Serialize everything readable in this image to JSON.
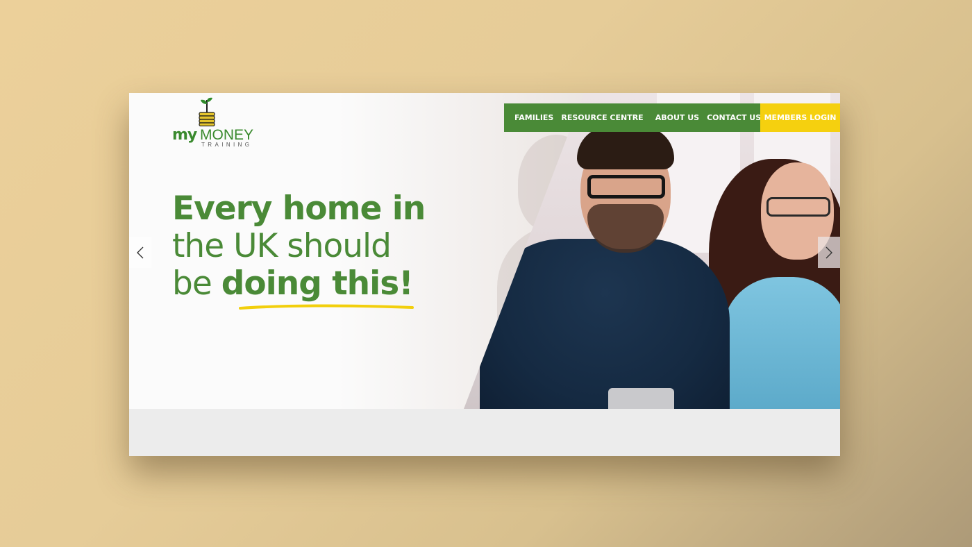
{
  "brand": {
    "logo_my": "my",
    "logo_money": "MONEY",
    "logo_sub": "TRAINING"
  },
  "nav": {
    "items": [
      "FAMILIES",
      "RESOURCE CENTRE",
      "ABOUT US",
      "CONTACT US"
    ],
    "login": "MEMBERS LOGIN"
  },
  "hero": {
    "line1": "Every home in",
    "line2": "the UK should",
    "line3_plain": "be",
    "line3_bold": "doing this!"
  },
  "colors": {
    "brand_green": "#4a8a37",
    "login_yellow": "#f5d00f",
    "underline_yellow": "#f2cf0c"
  },
  "icons": {
    "prev": "chevron-left-icon",
    "next": "chevron-right-icon",
    "logo": "coin-stack-sprout-icon"
  }
}
